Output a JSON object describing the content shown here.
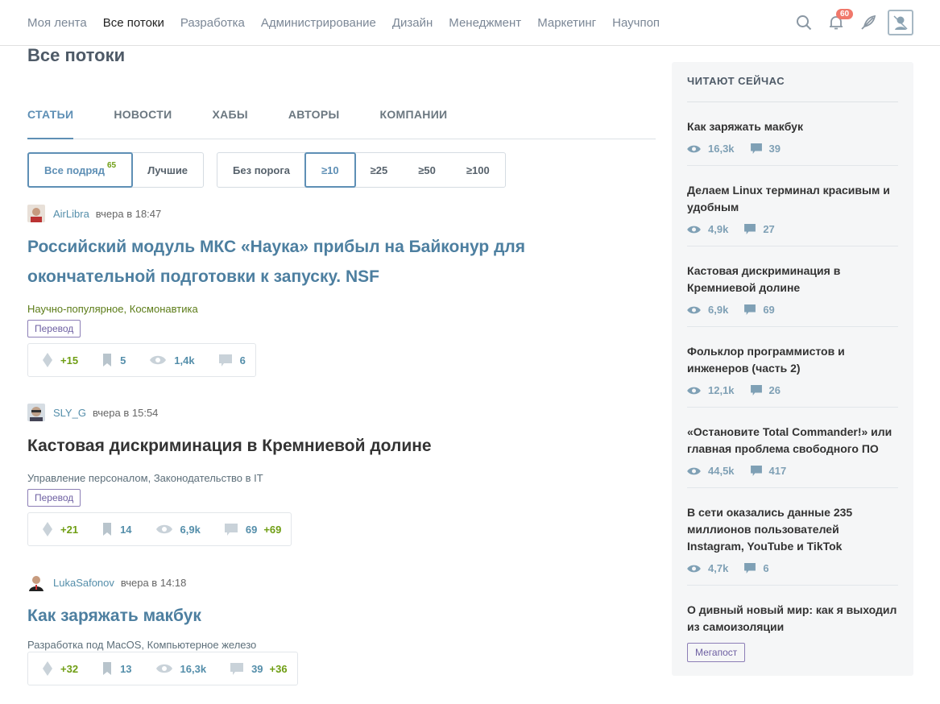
{
  "nav": {
    "items": [
      "Моя лента",
      "Все потоки",
      "Разработка",
      "Администрирование",
      "Дизайн",
      "Менеджмент",
      "Маркетинг",
      "Научпоп"
    ],
    "active": 1,
    "notifications": "60"
  },
  "page": {
    "title": "Все потоки",
    "tabs": [
      "СТАТЬИ",
      "НОВОСТИ",
      "ХАБЫ",
      "АВТОРЫ",
      "КОМПАНИИ"
    ]
  },
  "filters": {
    "all_label": "Все подряд",
    "all_count": "65",
    "best_label": "Лучшие",
    "thresholds": [
      "Без порога",
      "≥10",
      "≥25",
      "≥50",
      "≥100"
    ]
  },
  "posts": [
    {
      "author": "AirLibra",
      "time": "вчера в 18:47",
      "title": "Российский модуль МКС «Наука» прибыл на Байконур для окончательной подготовки к запуску. NSF",
      "hubs": [
        "Научно-популярное,",
        "Космонавтика"
      ],
      "tag": "Перевод",
      "rating": "+15",
      "bookmarks": "5",
      "views": "1,4k",
      "comments": "6",
      "comments_new": ""
    },
    {
      "author": "SLY_G",
      "time": "вчера в 15:54",
      "title": "Кастовая дискриминация в Кремниевой долине",
      "hubs": [
        "Управление персоналом,",
        "Законодательство в IT"
      ],
      "tag": "Перевод",
      "rating": "+21",
      "bookmarks": "14",
      "views": "6,9k",
      "comments": "69",
      "comments_new": "+69"
    },
    {
      "author": "LukaSafonov",
      "time": "вчера в 14:18",
      "title": "Как заряжать макбук",
      "hubs": [
        "Разработка под MacOS,",
        "Компьютерное железо"
      ],
      "tag": "",
      "rating": "+32",
      "bookmarks": "13",
      "views": "16,3k",
      "comments": "39",
      "comments_new": "+36"
    }
  ],
  "sidebar": {
    "title": "ЧИТАЮТ СЕЙЧАС",
    "items": [
      {
        "title": "Как заряжать макбук",
        "views": "16,3k",
        "comments": "39"
      },
      {
        "title": "Делаем Linux терминал красивым и удобным",
        "views": "4,9k",
        "comments": "27"
      },
      {
        "title": "Кастовая дискриминация в Кремниевой долине",
        "views": "6,9k",
        "comments": "69"
      },
      {
        "title": "Фольклор программистов и инженеров (часть 2)",
        "views": "12,1k",
        "comments": "26"
      },
      {
        "title": "«Остановите Total Commander!» или главная проблема свободного ПО",
        "views": "44,5k",
        "comments": "417"
      },
      {
        "title": "В сети оказались данные 235 миллионов пользователей Instagram, YouTube и TikTok",
        "views": "4,7k",
        "comments": "6"
      },
      {
        "title": "О дивный новый мир: как я выходил из самоизоляции",
        "badge": "Мегапост"
      }
    ]
  }
}
